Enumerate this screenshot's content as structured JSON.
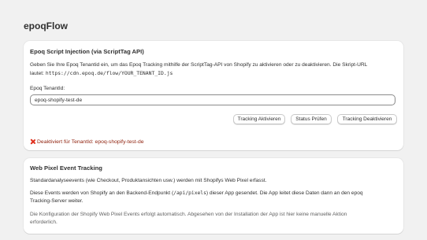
{
  "app": {
    "title": "epoqFlow"
  },
  "script_section": {
    "title": "Epoq Script Injection (via ScriptTag API)",
    "description_line1": "Geben Sie Ihre Epoq Tenantid ein, um das Epoq Tracking mithilfe der ScriptTag-API von Shopify zu aktivieren oder zu deaktivieren. Die Skript-URL",
    "description_prefix": "lautet:",
    "script_url": "https://cdn.epoq.de/flow/YOUR_TENANT_ID.js",
    "tenant_label": "Epoq TenantId:",
    "tenant_value": "epoq-shopify-test-de",
    "buttons": {
      "activate": "Tracking Aktivieren",
      "status": "Status Prüfen",
      "deactivate": "Tracking Deaktivieren"
    },
    "status_message": "Deaktiviert für TenantId: epoq-shopify-test-de",
    "status_color": "#8e1f0b"
  },
  "pixel_section": {
    "title": "Web Pixel Event Tracking",
    "para1": "Standardanalyseevents (wie Checkout, Produktansichten usw.) werden mit Shopifys Web Pixel erfasst.",
    "para2_before": "Diese Events werden von Shopify an den Backend-Endpunkt (",
    "para2_code": "/api/pixels",
    "para2_after": ") dieser App gesendet. Die App leitet diese Daten dann an den epoq",
    "para2_line2": "Tracking-Server weiter.",
    "para3_line1": "Die Konfiguration der Shopify Web Pixel Events erfolgt automatisch. Abgesehen von der Installation der App ist hier keine manuelle Aktion",
    "para3_line2": "erforderlich."
  }
}
